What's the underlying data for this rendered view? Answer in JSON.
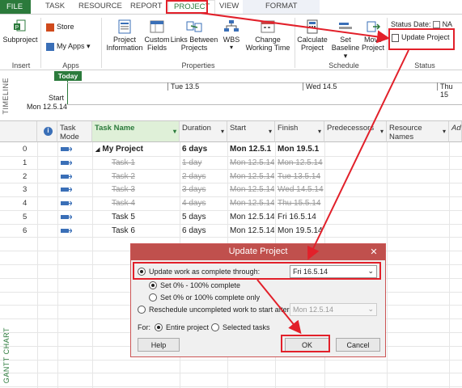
{
  "tabs": [
    "FILE",
    "TASK",
    "RESOURCE",
    "REPORT",
    "PROJECT",
    "VIEW",
    "FORMAT"
  ],
  "ribbon": {
    "insert": {
      "subproject": "Subproject",
      "group": "Insert"
    },
    "apps": {
      "store": "Store",
      "my_apps": "My Apps",
      "group": "Apps"
    },
    "properties": {
      "project_information": "Project Information",
      "custom_fields": "Custom Fields",
      "links_between_projects": "Links Between Projects",
      "wbs": "WBS",
      "change_working_time": "Change Working Time",
      "group": "Properties"
    },
    "schedule": {
      "calculate_project": "Calculate Project",
      "set_baseline": "Set Baseline",
      "move_project": "Move Project",
      "group": "Schedule"
    },
    "status": {
      "status_date_label": "Status Date:",
      "status_date_value": "NA",
      "update_project": "Update Project",
      "group": "Status"
    }
  },
  "timeline": {
    "label": "TIMELINE",
    "today": "Today",
    "ticks": [
      "Tue 13.5",
      "Wed 14.5",
      "Thu 15"
    ],
    "start_label": "Start",
    "start_date": "Mon 12.5.14"
  },
  "grid": {
    "side_label": "GANTT CHART",
    "headers": {
      "task_mode": "Task Mode",
      "task_name": "Task Name",
      "duration": "Duration",
      "start": "Start",
      "finish": "Finish",
      "predecessors": "Predecessors",
      "resource_names": "Resource Names",
      "add": "Ad"
    },
    "rows": [
      {
        "n": "0",
        "name": "My Project",
        "duration": "6 days",
        "start": "Mon 12.5.1",
        "finish": "Mon 19.5.1",
        "style": "summary"
      },
      {
        "n": "1",
        "name": "Task 1",
        "duration": "1 day",
        "start": "Mon 12.5.14",
        "finish": "Mon 12.5.14",
        "style": "done"
      },
      {
        "n": "2",
        "name": "Task 2",
        "duration": "2 days",
        "start": "Mon 12.5.14",
        "finish": "Tue 13.5.14",
        "style": "done"
      },
      {
        "n": "3",
        "name": "Task 3",
        "duration": "3 days",
        "start": "Mon 12.5.14",
        "finish": "Wed 14.5.14",
        "style": "done"
      },
      {
        "n": "4",
        "name": "Task 4",
        "duration": "4 days",
        "start": "Mon 12.5.14",
        "finish": "Thu 15.5.14",
        "style": "done"
      },
      {
        "n": "5",
        "name": "Task 5",
        "duration": "5 days",
        "start": "Mon 12.5.14",
        "finish": "Fri 16.5.14",
        "style": "normal"
      },
      {
        "n": "6",
        "name": "Task 6",
        "duration": "6 days",
        "start": "Mon 12.5.14",
        "finish": "Mon 19.5.14",
        "style": "normal"
      }
    ]
  },
  "dialog": {
    "title": "Update Project",
    "close": "✕",
    "opt_update": "Update work as complete through:",
    "update_date": "Fri 16.5.14",
    "opt_set_range": "Set 0% - 100% complete",
    "opt_set_binary": "Set 0% or 100% complete only",
    "opt_reschedule": "Reschedule uncompleted work to start after:",
    "reschedule_date": "Mon 12.5.14",
    "for_label": "For:",
    "opt_entire": "Entire project",
    "opt_selected": "Selected tasks",
    "help": "Help",
    "ok": "OK",
    "cancel": "Cancel"
  },
  "colors": {
    "accent": "#2b7a3b",
    "annotation": "#e2202a",
    "dialog_title": "#c0504d"
  }
}
